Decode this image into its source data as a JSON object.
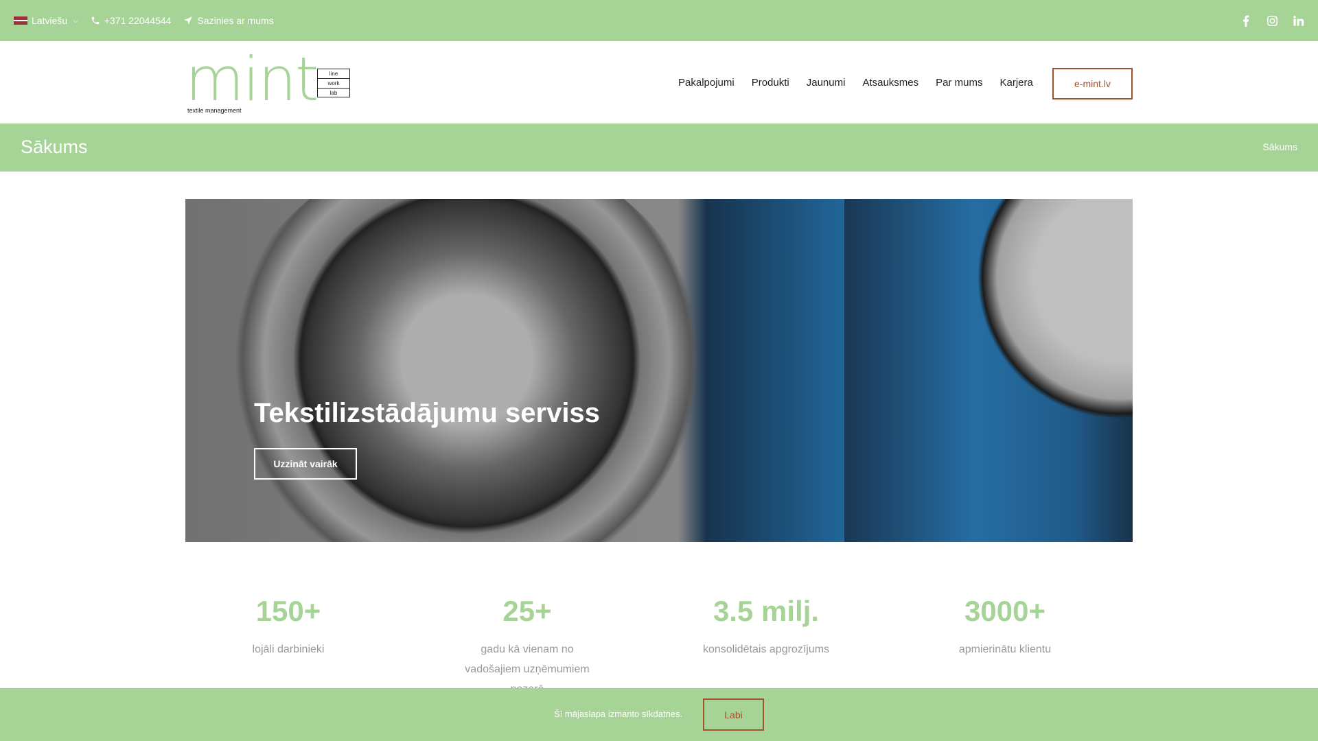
{
  "topbar": {
    "language": "Latviešu",
    "phone": "+371 22044544",
    "contact": "Sazinies ar mums",
    "social": [
      "facebook-icon",
      "instagram-icon",
      "linkedin-icon"
    ]
  },
  "header": {
    "logo_word": "mint",
    "logo_sub": "textile management",
    "logo_box": [
      "line",
      "work",
      "lab"
    ],
    "nav": [
      "Pakalpojumi",
      "Produkti",
      "Jaunumi",
      "Atsauksmes",
      "Par mums",
      "Karjera"
    ],
    "cta": "e-mint.lv"
  },
  "titlebar": {
    "title": "Sākums",
    "breadcrumb": "Sākums"
  },
  "hero": {
    "title": "Tekstilizstādājumu serviss",
    "button": "Uzzināt vairāk"
  },
  "stats": [
    {
      "value": "150+",
      "label": "lojāli darbinieki"
    },
    {
      "value": "25+",
      "label": "gadu kā vienam no vadošajiem uzņēmumiem nozarē"
    },
    {
      "value": "3.5 milj.",
      "label": "konsolidētais apgrozījums"
    },
    {
      "value": "3000+",
      "label": "apmierinātu klientu"
    }
  ],
  "cookie": {
    "text": "Šī mājaslapa izmanto sīkdatnes.",
    "button": "Labi"
  },
  "colors": {
    "brand_green": "#a6d396",
    "accent_brown": "#a0522d"
  }
}
